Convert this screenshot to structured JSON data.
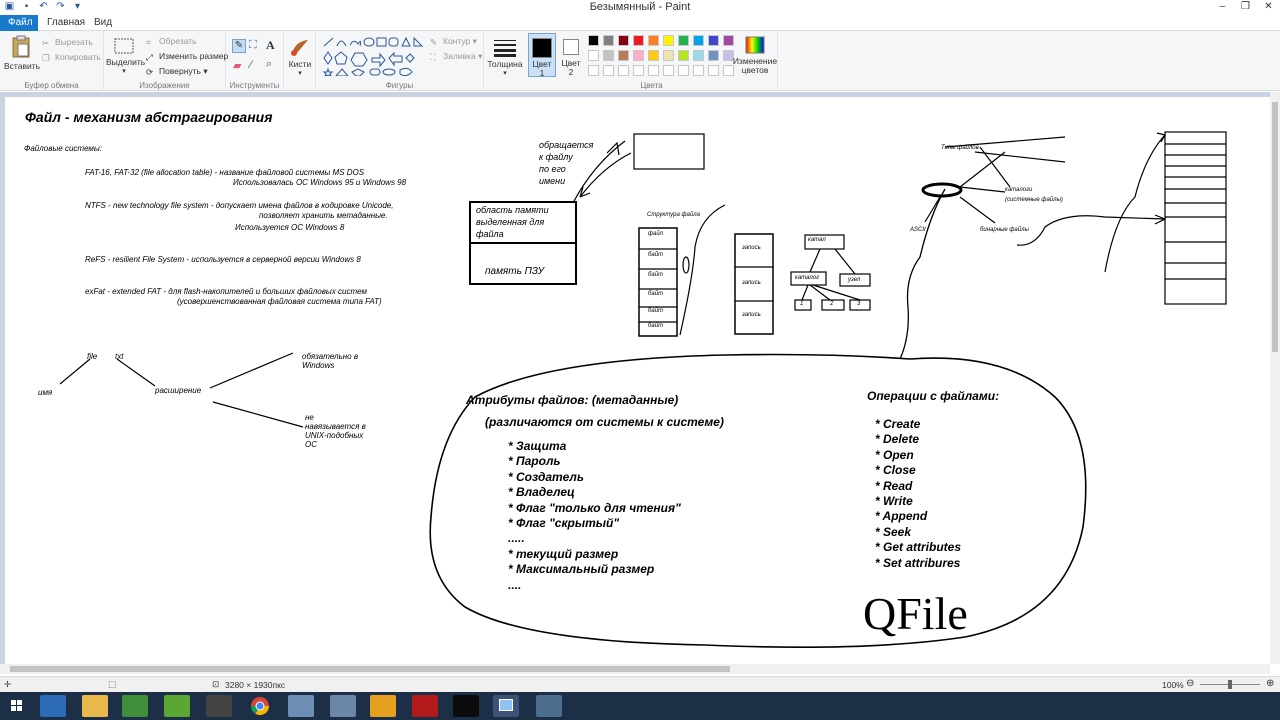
{
  "window": {
    "title": "Безымянный - Paint"
  },
  "tabs": [
    {
      "label": "Файл"
    },
    {
      "label": "Главная"
    },
    {
      "label": "Вид"
    }
  ],
  "ribbon": {
    "clipboard": {
      "paste": "Вставить",
      "cut": "Вырезать",
      "copy": "Копировать",
      "group": "Буфер обмена"
    },
    "image": {
      "select": "Выделить",
      "crop": "Обрезать",
      "resize": "Изменить размер",
      "rotate": "Повернуть",
      "group": "Изображение"
    },
    "tools": {
      "group": "Инструменты",
      "text_tool": "A"
    },
    "brushes": {
      "label": "Кисти"
    },
    "shapes": {
      "outline": "Контур",
      "fill": "Заливка",
      "group": "Фигуры"
    },
    "size": {
      "label": "Толщина"
    },
    "color1": {
      "label": "Цвет 1"
    },
    "color2": {
      "label": "Цвет 2"
    },
    "colors": {
      "group": "Цвета",
      "edit": "Изменение цветов",
      "palette_row1": [
        "#000000",
        "#7f7f7f",
        "#880015",
        "#ed1c24",
        "#ff7f27",
        "#fff200",
        "#22b14c",
        "#00a2e8",
        "#3f48cc",
        "#a349a4"
      ],
      "palette_row2": [
        "#ffffff",
        "#c3c3c3",
        "#b97a57",
        "#ffaec9",
        "#ffc90e",
        "#efe4b0",
        "#b5e61d",
        "#99d9ea",
        "#7092be",
        "#c8bfe7"
      ]
    }
  },
  "canvas": {
    "title": "Файл - механизм абстрагирования",
    "fs_label": "Файловые системы:",
    "fat": "FAT-16, FAT-32 (file allocation table) - название файловой системы MS DOS",
    "fat2": "Использовалась ОС Windows 95 и Windows 98",
    "ntfs": "NTFS - new technology file system  - допускает имена файлов в кодировке Unicode,",
    "ntfs2": "позволяет хранить метаданные.",
    "ntfs3": "Используется ОС Windows 8",
    "refs": "ReFS - resilient File System - используется в серверной версии Windows 8",
    "exfat": "exFat - extended FAT - для flash-накопителей и больших файловых систем",
    "exfat2": "(усовершенствованная файловая система типа FAT)",
    "file_word": "file",
    "txt_word": "txt",
    "name_word": "имя",
    "ext_word": "расширение",
    "must_win1": "обязательно в",
    "must_win2": "Windows",
    "not_unix1": "не",
    "not_unix2": "навязывается в",
    "not_unix3": "UNIX-подобных",
    "not_unix4": "ОС",
    "access1": "обращается",
    "access2": "к файлу",
    "access3": "по его",
    "access4": "имени",
    "mem_area1": "область памяти",
    "mem_area2": "выделенная для",
    "mem_area3": "файла",
    "rom": "память ПЗУ",
    "struct_label": "Структура файла",
    "struct_cells": [
      "файл",
      "байт",
      "байт",
      "байт",
      "байт",
      "байт"
    ],
    "mem_side": [
      "запись",
      "запись",
      "запись"
    ],
    "tree_root": "катал",
    "tree_left": "каталог",
    "tree_right": "узел",
    "tree_leaves": [
      "1",
      "2",
      "3"
    ],
    "attrs_title": "Атрибуты файлов:   (метаданные)",
    "attrs_sub": "(различаются от системы к системе)",
    "attrs": [
      "* Защита",
      "* Пароль",
      "* Создатель",
      "* Владелец",
      "* Флаг \"только для чтения\"",
      "* Флаг \"скрытый\"",
      ".....",
      "* текущий размер",
      "* Максимальный размер",
      "...."
    ],
    "ops_title": "Операции с файлами:",
    "ops": [
      "* Create",
      "* Delete",
      "* Open",
      "* Close",
      "* Read",
      "* Write",
      "* Append",
      "* Seek",
      "* Get attributes",
      "* Set attribures"
    ],
    "qfile": "QFile",
    "file_types": "Типы файлов",
    "special_files": "каталоги",
    "system_files": "(системные файлы)",
    "ascii": "ASCII",
    "binary": "бинарные файлы"
  },
  "statusbar": {
    "dimensions": "3280 × 1930пкс",
    "zoom": "100%"
  }
}
